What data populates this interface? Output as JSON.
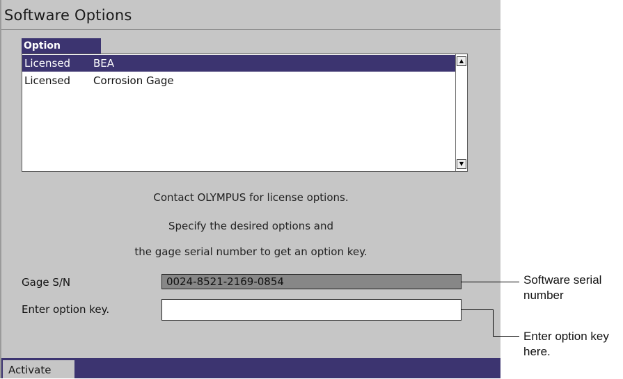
{
  "window": {
    "title": "Software Options"
  },
  "options_list": {
    "column_header": "Option",
    "rows": [
      {
        "status": "Licensed",
        "name": "BEA",
        "selected": true
      },
      {
        "status": "Licensed",
        "name": "Corrosion Gage",
        "selected": false
      }
    ]
  },
  "info": {
    "line1": "Contact OLYMPUS for license options.",
    "line2": "Specify the desired options and",
    "line3": "the gage serial number to get an option key."
  },
  "serial": {
    "label": "Gage S/N",
    "value": "0024-8521-2169-0854"
  },
  "option_key": {
    "label": "Enter option key.",
    "value": ""
  },
  "toolbar": {
    "activate_label": "Activate"
  },
  "callouts": {
    "serial_line1": "Software serial",
    "serial_line2": "number",
    "key_line1": "Enter option key",
    "key_line2": "here."
  },
  "colors": {
    "panel": "#c6c6c6",
    "accent": "#3c3470",
    "serial_box": "#878787"
  }
}
